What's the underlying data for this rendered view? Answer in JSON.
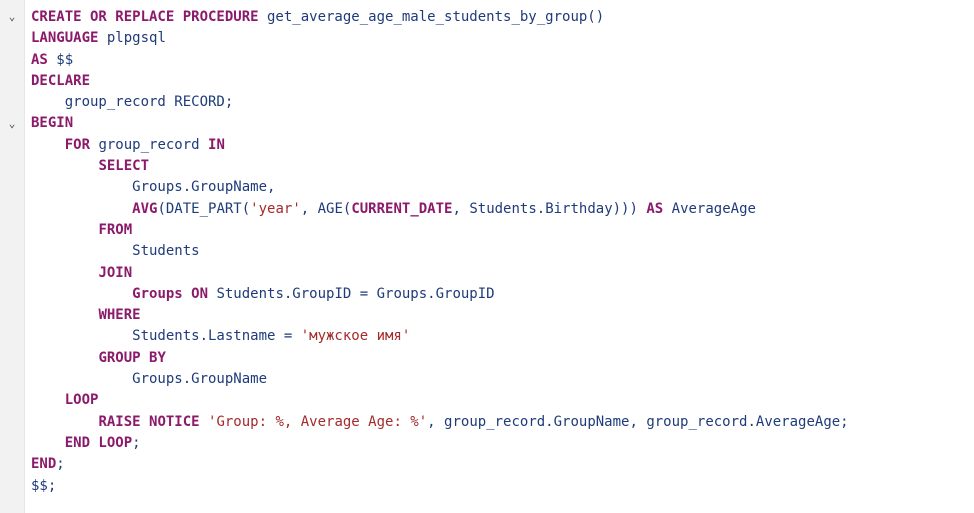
{
  "fold_icons": [
    "chevron-down",
    "chevron-down"
  ],
  "lines": [
    [
      {
        "t": "kw",
        "v": "CREATE OR REPLACE PROCEDURE"
      },
      {
        "t": "id",
        "v": " get_average_age_male_students_by_group()"
      }
    ],
    [
      {
        "t": "kw",
        "v": "LANGUAGE"
      },
      {
        "t": "id",
        "v": " plpgsql"
      }
    ],
    [
      {
        "t": "kw",
        "v": "AS"
      },
      {
        "t": "id",
        "v": " $$"
      }
    ],
    [
      {
        "t": "kw",
        "v": "DECLARE"
      }
    ],
    [
      {
        "t": "id",
        "v": "    group_record RECORD;"
      }
    ],
    [
      {
        "t": "kw",
        "v": "BEGIN"
      }
    ],
    [
      {
        "t": "id",
        "v": "    "
      },
      {
        "t": "kw",
        "v": "FOR"
      },
      {
        "t": "id",
        "v": " group_record "
      },
      {
        "t": "kw",
        "v": "IN"
      }
    ],
    [
      {
        "t": "id",
        "v": "        "
      },
      {
        "t": "kw",
        "v": "SELECT"
      }
    ],
    [
      {
        "t": "id",
        "v": "            Groups.GroupName,"
      }
    ],
    [
      {
        "t": "id",
        "v": "            "
      },
      {
        "t": "kw",
        "v": "AVG"
      },
      {
        "t": "id",
        "v": "(DATE_PART("
      },
      {
        "t": "str",
        "v": "'year'"
      },
      {
        "t": "id",
        "v": ", AGE("
      },
      {
        "t": "kw",
        "v": "CURRENT_DATE"
      },
      {
        "t": "id",
        "v": ", Students.Birthday))) "
      },
      {
        "t": "kw",
        "v": "AS"
      },
      {
        "t": "id",
        "v": " AverageAge"
      }
    ],
    [
      {
        "t": "id",
        "v": "        "
      },
      {
        "t": "kw",
        "v": "FROM"
      }
    ],
    [
      {
        "t": "id",
        "v": "            Students"
      }
    ],
    [
      {
        "t": "id",
        "v": "        "
      },
      {
        "t": "kw",
        "v": "JOIN"
      }
    ],
    [
      {
        "t": "id",
        "v": "            "
      },
      {
        "t": "kw",
        "v": "Groups ON"
      },
      {
        "t": "id",
        "v": " Students.GroupID = Groups.GroupID"
      }
    ],
    [
      {
        "t": "id",
        "v": "        "
      },
      {
        "t": "kw",
        "v": "WHERE"
      }
    ],
    [
      {
        "t": "id",
        "v": "            Students.Lastname = "
      },
      {
        "t": "str",
        "v": "'мужское имя'"
      }
    ],
    [
      {
        "t": "id",
        "v": "        "
      },
      {
        "t": "kw",
        "v": "GROUP BY"
      }
    ],
    [
      {
        "t": "id",
        "v": "            Groups.GroupName"
      }
    ],
    [
      {
        "t": "id",
        "v": "    "
      },
      {
        "t": "kw",
        "v": "LOOP"
      }
    ],
    [
      {
        "t": "id",
        "v": "        "
      },
      {
        "t": "kw",
        "v": "RAISE NOTICE"
      },
      {
        "t": "str",
        "v": " 'Group: %, Average Age: %'"
      },
      {
        "t": "id",
        "v": ", group_record.GroupName, group_record.AverageAge;"
      }
    ],
    [
      {
        "t": "id",
        "v": "    "
      },
      {
        "t": "kw",
        "v": "END LOOP"
      },
      {
        "t": "id",
        "v": ";"
      }
    ],
    [
      {
        "t": "kw",
        "v": "END"
      },
      {
        "t": "id",
        "v": ";"
      }
    ],
    [
      {
        "t": "id",
        "v": "$$;"
      }
    ]
  ]
}
